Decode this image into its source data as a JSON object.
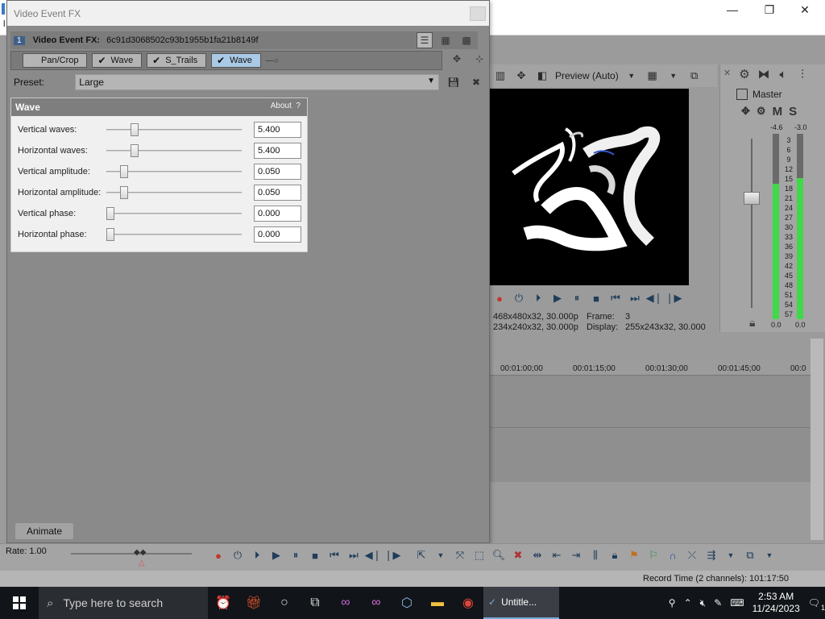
{
  "app": {
    "title_char": "l",
    "window_controls": {
      "minimize": "—",
      "maximize": "❐",
      "close": "✕"
    }
  },
  "fx_dialog": {
    "title": "Video Event FX",
    "chain": {
      "index": "1",
      "title": "Video Event FX:",
      "id": "6c91d3068502c93b1955b1fa21b8149f"
    },
    "plugins": [
      {
        "label": "Pan/Crop",
        "checked": false
      },
      {
        "label": "Wave",
        "checked": true
      },
      {
        "label": "S_Trails",
        "checked": true
      },
      {
        "label": "Wave",
        "checked": true,
        "selected": true
      }
    ],
    "preset": {
      "label": "Preset:",
      "value": "Large"
    },
    "panel": {
      "title": "Wave",
      "about": "About",
      "help": "?",
      "params": [
        {
          "label": "Vertical waves:",
          "value": "5.400",
          "level": 0.18
        },
        {
          "label": "Horizontal waves:",
          "value": "5.400",
          "level": 0.18
        },
        {
          "label": "Vertical amplitude:",
          "value": "0.050",
          "level": 0.1
        },
        {
          "label": "Horizontal amplitude:",
          "value": "0.050",
          "level": 0.1
        },
        {
          "label": "Vertical phase:",
          "value": "0.000",
          "level": 0.0
        },
        {
          "label": "Horizontal phase:",
          "value": "0.000",
          "level": 0.0
        }
      ]
    },
    "animate_label": "Animate"
  },
  "preview": {
    "quality": "Preview (Auto)",
    "info": {
      "project": "468x480x32, 30.000p",
      "preview": "234x240x32, 30.000p",
      "frame_label": "Frame:",
      "frame_value": "3",
      "display_label": "Display:",
      "display_value": "255x243x32, 30.000"
    }
  },
  "master": {
    "label": "Master",
    "mute": "M",
    "solo": "S",
    "peak_left": "-4.6",
    "peak_right": "-3.0",
    "scale": [
      "3",
      "6",
      "9",
      "12",
      "15",
      "18",
      "21",
      "24",
      "27",
      "30",
      "33",
      "36",
      "39",
      "42",
      "45",
      "48",
      "51",
      "54",
      "57"
    ],
    "bottom_left": "0.0",
    "bottom_right": "0.0",
    "level_left": 0.73,
    "level_right": 0.76
  },
  "timeline": {
    "ruler": [
      "00:01:00;00",
      "00:01:15;00",
      "00:01:30;00",
      "00:01:45;00",
      "00:0"
    ]
  },
  "transport": {
    "rate": "Rate: 1.00"
  },
  "status": {
    "record_time": "Record Time (2 channels): 101:17:50"
  },
  "taskbar": {
    "search_placeholder": "Type here to search",
    "active_app": "Untitle...",
    "time": "2:53 AM",
    "date": "11/24/2023",
    "notifications": "1"
  }
}
